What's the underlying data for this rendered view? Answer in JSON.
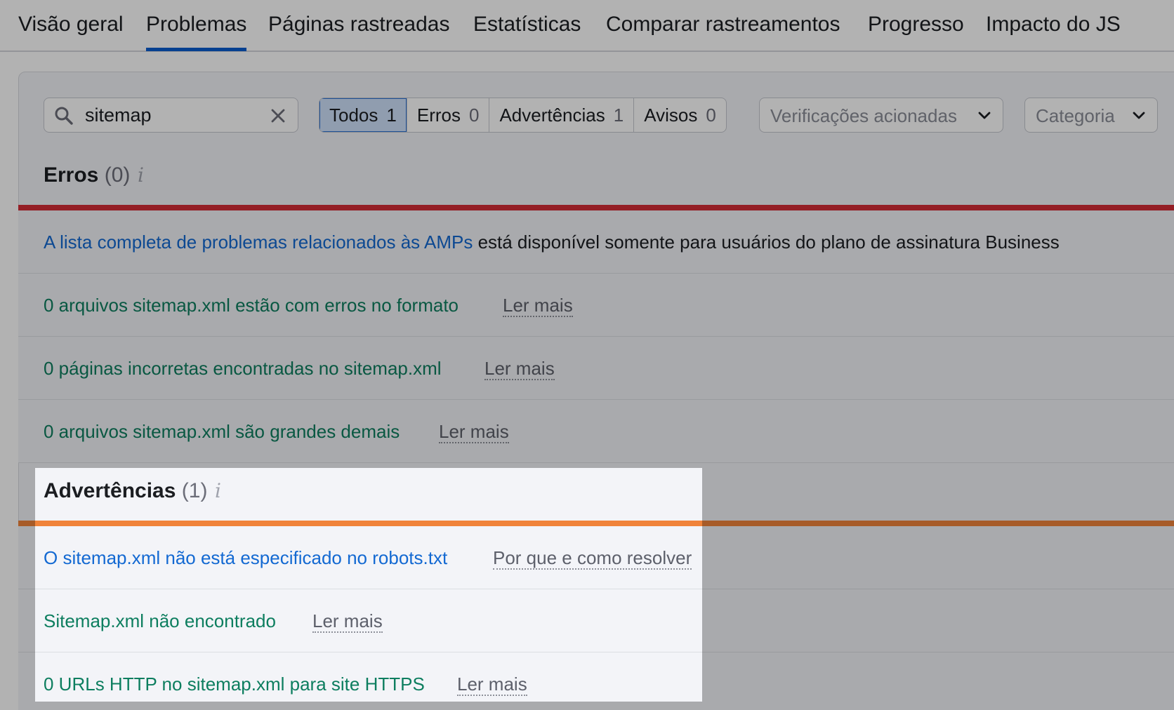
{
  "tabs": [
    {
      "label": "Visão geral"
    },
    {
      "label": "Problemas"
    },
    {
      "label": "Páginas rastreadas"
    },
    {
      "label": "Estatísticas"
    },
    {
      "label": "Comparar rastreamentos"
    },
    {
      "label": "Progresso"
    },
    {
      "label": "Impacto do JS"
    }
  ],
  "active_tab": "Problemas",
  "search": {
    "value": "sitemap",
    "icon": "search-icon",
    "clear_icon": "close-icon"
  },
  "filters": [
    {
      "label": "Todos",
      "count": "1"
    },
    {
      "label": "Erros",
      "count": "0"
    },
    {
      "label": "Advertências",
      "count": "1"
    },
    {
      "label": "Avisos",
      "count": "0"
    }
  ],
  "dropdowns": {
    "checks": "Verificações acionadas",
    "category": "Categoria"
  },
  "errors": {
    "title": "Erros",
    "count": "(0)",
    "info": "i",
    "color": "#d52b36",
    "notice_link": "A lista completa de problemas relacionados às AMPs",
    "notice_text": "está disponível somente para usuários do plano de assinatura Business",
    "rows": [
      {
        "text": "0 arquivos sitemap.xml estão com erros no formato",
        "more": "Ler mais"
      },
      {
        "text": "0 páginas incorretas encontradas no sitemap.xml",
        "more": "Ler mais"
      },
      {
        "text": "0 arquivos sitemap.xml são grandes demais",
        "more": "Ler mais"
      }
    ]
  },
  "warnings": {
    "title": "Advertências",
    "count": "(1)",
    "info": "i",
    "color": "#f0833a",
    "rows": [
      {
        "text": "O sitemap.xml não está especificado no robots.txt",
        "more": "Por que e como resolver"
      },
      {
        "text": "Sitemap.xml não encontrado",
        "more": "Ler mais"
      },
      {
        "text": "0 URLs HTTP no sitemap.xml para site HTTPS",
        "more": "Ler mais"
      }
    ]
  }
}
